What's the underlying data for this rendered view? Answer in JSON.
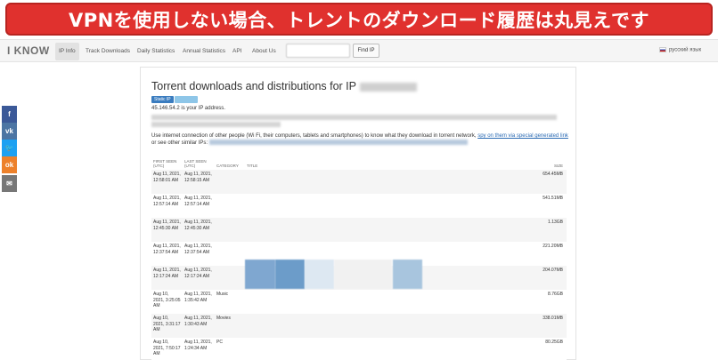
{
  "banner": {
    "text": "VPNを使用しない場合、トレントのダウンロード履歴は丸見えです",
    "color": "#e0312e"
  },
  "navbar": {
    "brand": "I KNOW",
    "items": [
      {
        "label": "IP Info",
        "active": true
      },
      {
        "label": "Track Downloads",
        "active": false
      },
      {
        "label": "Daily Statistics",
        "active": false
      },
      {
        "label": "Annual Statistics",
        "active": false
      },
      {
        "label": "API",
        "active": false
      },
      {
        "label": "About Us",
        "active": false
      }
    ],
    "search_placeholder": "",
    "find_button": "Find IP",
    "language": "русский язык"
  },
  "social": [
    {
      "icon": "facebook-icon",
      "glyph": "f",
      "color": "#3b5998"
    },
    {
      "icon": "vk-icon",
      "glyph": "vk",
      "color": "#4c75a3"
    },
    {
      "icon": "twitter-icon",
      "glyph": "🐦",
      "color": "#1da1f2"
    },
    {
      "icon": "odnoklassniki-icon",
      "glyph": "ok",
      "color": "#ed812b"
    },
    {
      "icon": "email-icon",
      "glyph": "✉",
      "color": "#777777"
    }
  ],
  "main": {
    "title": "Torrent downloads and distributions for IP",
    "badge_static": "Static IP",
    "badge_color": "#3a7cbf",
    "ip_line": "45.146.54.2 is your IP address.",
    "desc_text": "Use internet connection of other people (Wi Fi, their computers, tablets and smartphones) to know what they download in torrent network,",
    "desc_link": "spy on them via special generated link",
    "desc_tail": "or see other similar IPs:"
  },
  "table": {
    "headers": [
      "FIRST SEEN (UTC)",
      "LAST SEEN (UTC)",
      "CATEGORY",
      "TITLE",
      "SIZE"
    ],
    "rows": [
      {
        "first": "Aug 11, 2021, 12:58:01 AM",
        "last": "Aug 11, 2021, 12:58:15 AM",
        "category": "",
        "size": "654.45MB"
      },
      {
        "first": "Aug 11, 2021, 12:57:14 AM",
        "last": "Aug 11, 2021, 12:57:14 AM",
        "category": "",
        "size": "541.51MB"
      },
      {
        "first": "Aug 11, 2021, 12:45:30 AM",
        "last": "Aug 11, 2021, 12:45:30 AM",
        "category": "",
        "size": "1.13GB"
      },
      {
        "first": "Aug 11, 2021, 12:37:54 AM",
        "last": "Aug 11, 2021, 12:37:54 AM",
        "category": "",
        "size": "221.20MB"
      },
      {
        "first": "Aug 11, 2021, 12:17:24 AM",
        "last": "Aug 11, 2021, 12:17:24 AM",
        "category": "",
        "size": "204.07MB"
      },
      {
        "first": "Aug 10, 2021, 3:25:05 AM",
        "last": "Aug 11, 2021, 1:35:42 AM",
        "category": "Music",
        "size": "8.76GB"
      },
      {
        "first": "Aug 10, 2021, 3:31:17 AM",
        "last": "Aug 11, 2021, 1:30:43 AM",
        "category": "Movies",
        "size": "338.01MB"
      },
      {
        "first": "Aug 10, 2021, 7:50:17 AM",
        "last": "Aug 11, 2021, 1:24:34 AM",
        "category": "PC",
        "size": "80.25GB"
      }
    ]
  }
}
